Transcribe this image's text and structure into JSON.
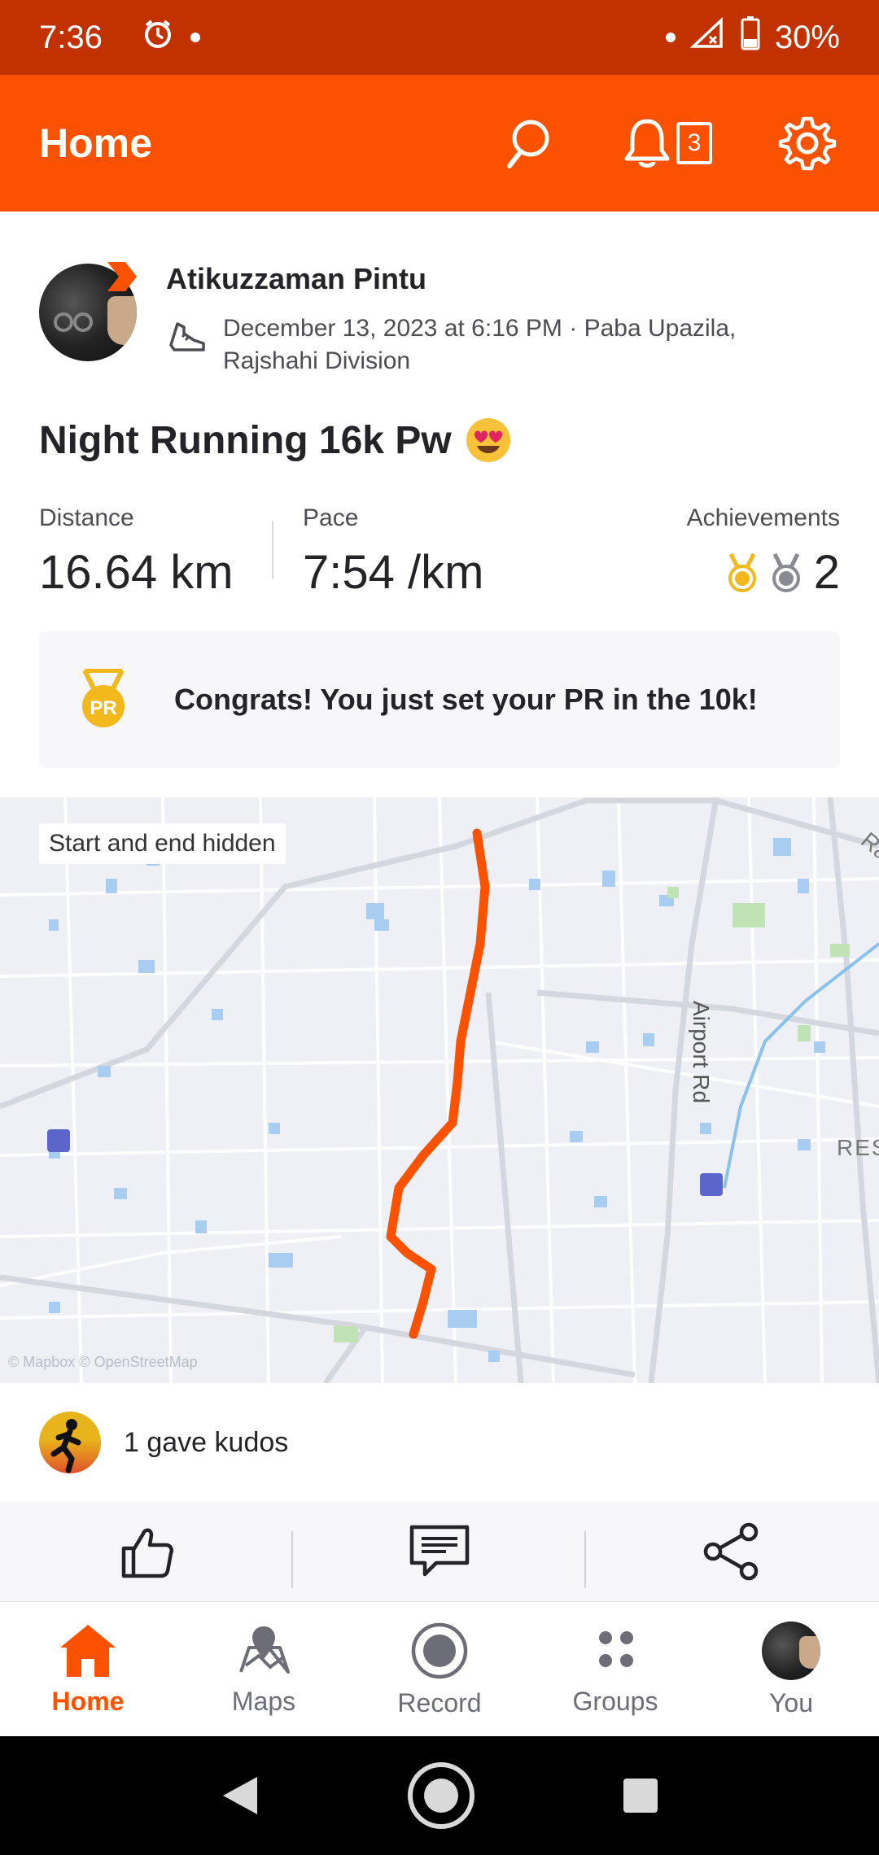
{
  "status_bar": {
    "time": "7:36",
    "battery": "30%",
    "icons": [
      "alarm-icon",
      "dot-icon",
      "dot-icon",
      "signal-icon",
      "battery-icon"
    ]
  },
  "app_bar": {
    "title": "Home",
    "notification_count": "3",
    "icons": [
      "search-icon",
      "bell-icon",
      "gear-icon"
    ]
  },
  "activity": {
    "athlete_name": "Atikuzzaman Pintu",
    "meta": "December 13, 2023 at 6:16 PM · Paba Upazila, Rajshahi Division",
    "title": "Night Running 16k Pw",
    "title_emoji": "heart-eyes-emoji",
    "stats": {
      "distance_label": "Distance",
      "distance_value": "16.64 km",
      "pace_label": "Pace",
      "pace_value": "7:54 /km",
      "achievements_label": "Achievements",
      "achievements_value": "2"
    },
    "pr_banner": "Congrats! You just set your PR in the 10k!"
  },
  "map": {
    "label": "Start and end hidden",
    "road_label": "Airport Rd",
    "edge_label": "RES",
    "edge_label_2": "Ra",
    "attribution": "© Mapbox © OpenStreetMap",
    "route_color": "#fc5200"
  },
  "kudos": {
    "text": "1 gave kudos"
  },
  "actions": [
    "like-icon",
    "comment-icon",
    "share-icon"
  ],
  "bottom_nav": {
    "items": [
      {
        "label": "Home",
        "active": true
      },
      {
        "label": "Maps",
        "active": false
      },
      {
        "label": "Record",
        "active": false
      },
      {
        "label": "Groups",
        "active": false
      },
      {
        "label": "You",
        "active": false
      }
    ]
  },
  "colors": {
    "brand": "#fc5200",
    "status_bar": "#c13200"
  }
}
